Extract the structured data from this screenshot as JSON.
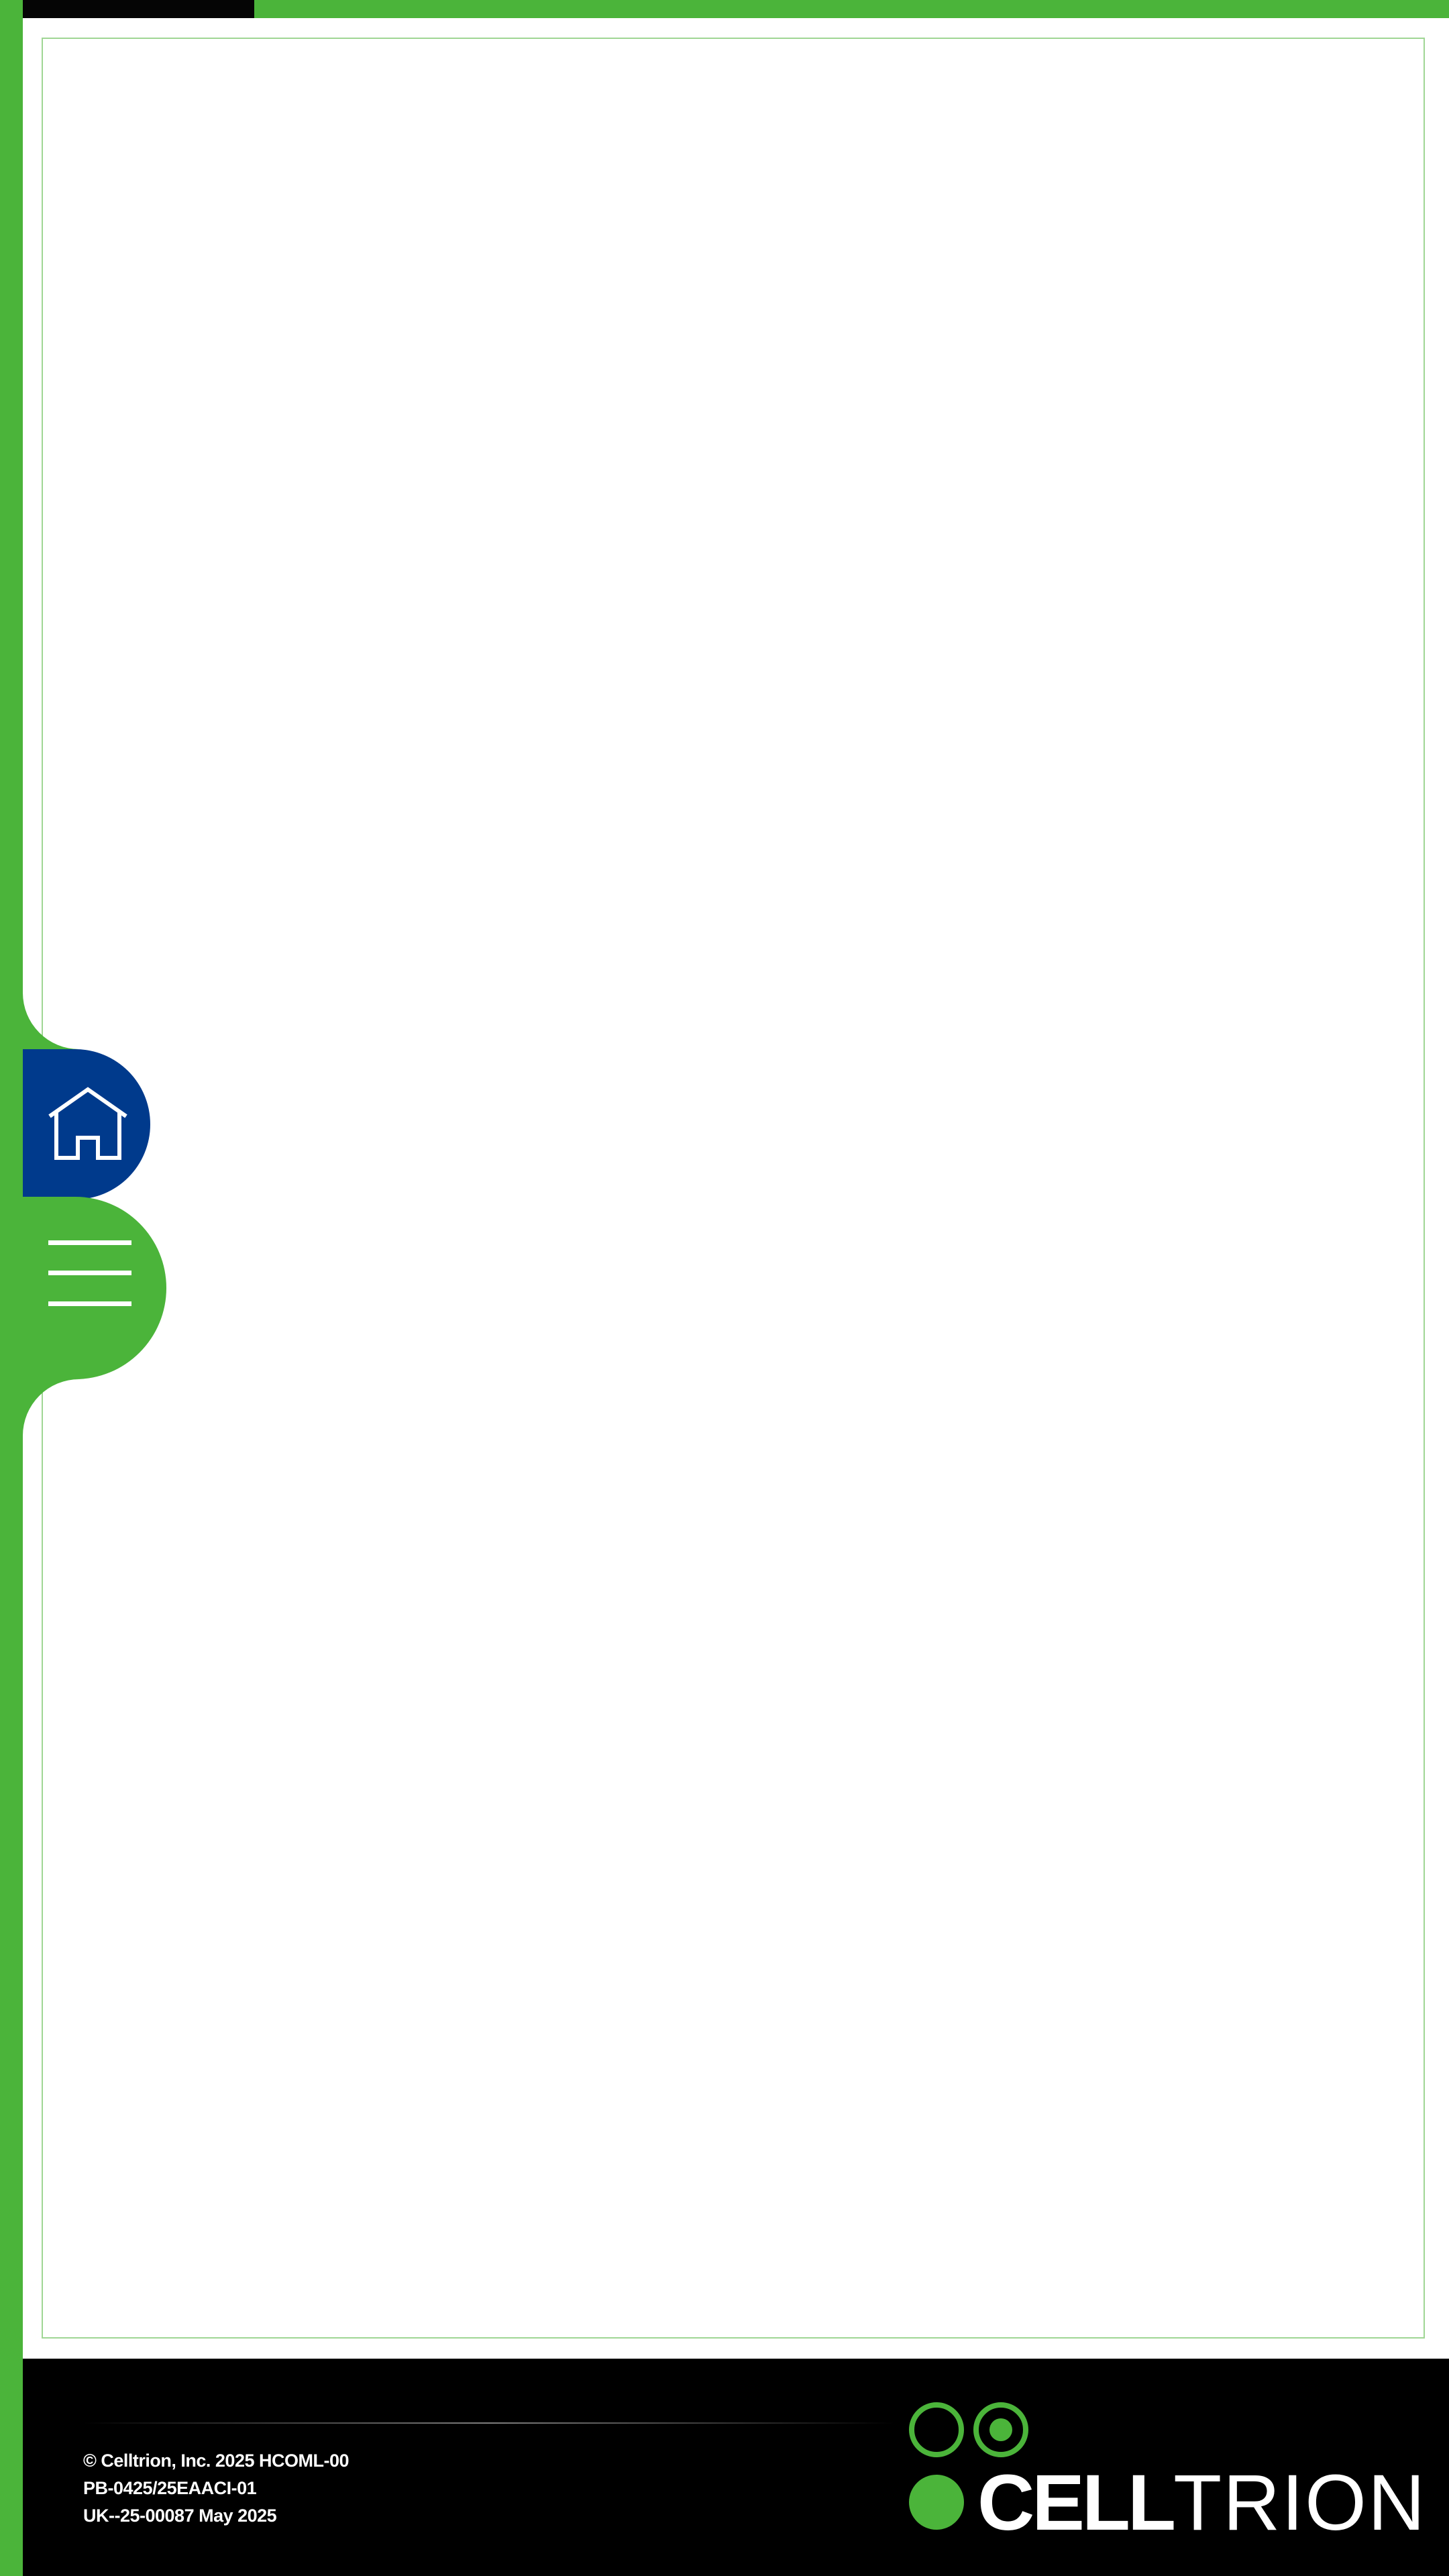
{
  "navigation": {
    "home": {
      "icon": "home-icon",
      "label": "Home"
    },
    "menu": {
      "icon": "hamburger-menu-icon",
      "label": "Menu"
    }
  },
  "footer": {
    "lines": [
      "© Celltrion, Inc. 2025 HCOML-00",
      "PB-0425/25EAACI-01",
      "UK--25-00087 May 2025"
    ],
    "logo": {
      "word_bold": "CELL",
      "word_light": "TRION"
    }
  },
  "colors": {
    "brand_green": "#4bb43a",
    "home_blue": "#003a8c",
    "footer_black": "#000000",
    "frame_border": "#9fd694"
  }
}
